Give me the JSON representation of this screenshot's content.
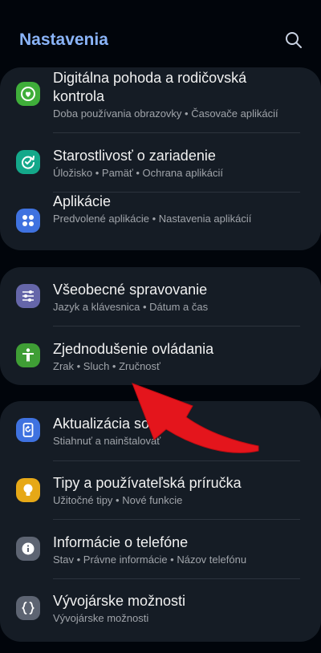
{
  "header": {
    "title": "Nastavenia",
    "search_icon": "search-icon"
  },
  "colors": {
    "accent": "#8ab4f8",
    "card": "#151c25",
    "background": "#01050b",
    "arrow": "#e4151c"
  },
  "groups": [
    {
      "items": [
        {
          "title": "Digitálna pohoda a rodičovská kontrola",
          "subtitle": "Doba používania obrazovky • Časovače aplikácií",
          "icon": "digital-wellbeing-icon",
          "icon_color": "#3fae3a"
        },
        {
          "title": "Starostlivosť o zariadenie",
          "subtitle": "Úložisko • Pamäť • Ochrana aplikácií",
          "icon": "device-care-icon",
          "icon_color": "#14a88a"
        },
        {
          "title": "Aplikácie",
          "subtitle": "Predvolené aplikácie • Nastavenia aplikácií",
          "icon": "apps-icon",
          "icon_color": "#3f72e0"
        }
      ]
    },
    {
      "items": [
        {
          "title": "Všeobecné spravovanie",
          "subtitle": "Jazyk a klávesnica • Dátum a čas",
          "icon": "general-management-icon",
          "icon_color": "#6566a9"
        },
        {
          "title": "Zjednodušenie ovládania",
          "subtitle": "Zrak • Sluch • Zručnosť",
          "icon": "accessibility-icon",
          "icon_color": "#3f9e35"
        }
      ]
    },
    {
      "items": [
        {
          "title": "Aktualizácia softvéru",
          "subtitle": "Stiahnuť a nainštalovať",
          "icon": "software-update-icon",
          "icon_color": "#3f72e0"
        },
        {
          "title": "Tipy a používateľská príručka",
          "subtitle": "Užitočné tipy • Nové funkcie",
          "icon": "tips-icon",
          "icon_color": "#e6a817"
        },
        {
          "title": "Informácie o telefóne",
          "subtitle": "Stav • Právne informácie • Názov telefónu",
          "icon": "info-icon",
          "icon_color": "#5d6472"
        },
        {
          "title": "Vývojárske možnosti",
          "subtitle": "Vývojárske možnosti",
          "icon": "developer-options-icon",
          "icon_color": "#5d6472"
        }
      ]
    }
  ],
  "overlay": {
    "arrow_icon": "red-arrow-annotation"
  }
}
